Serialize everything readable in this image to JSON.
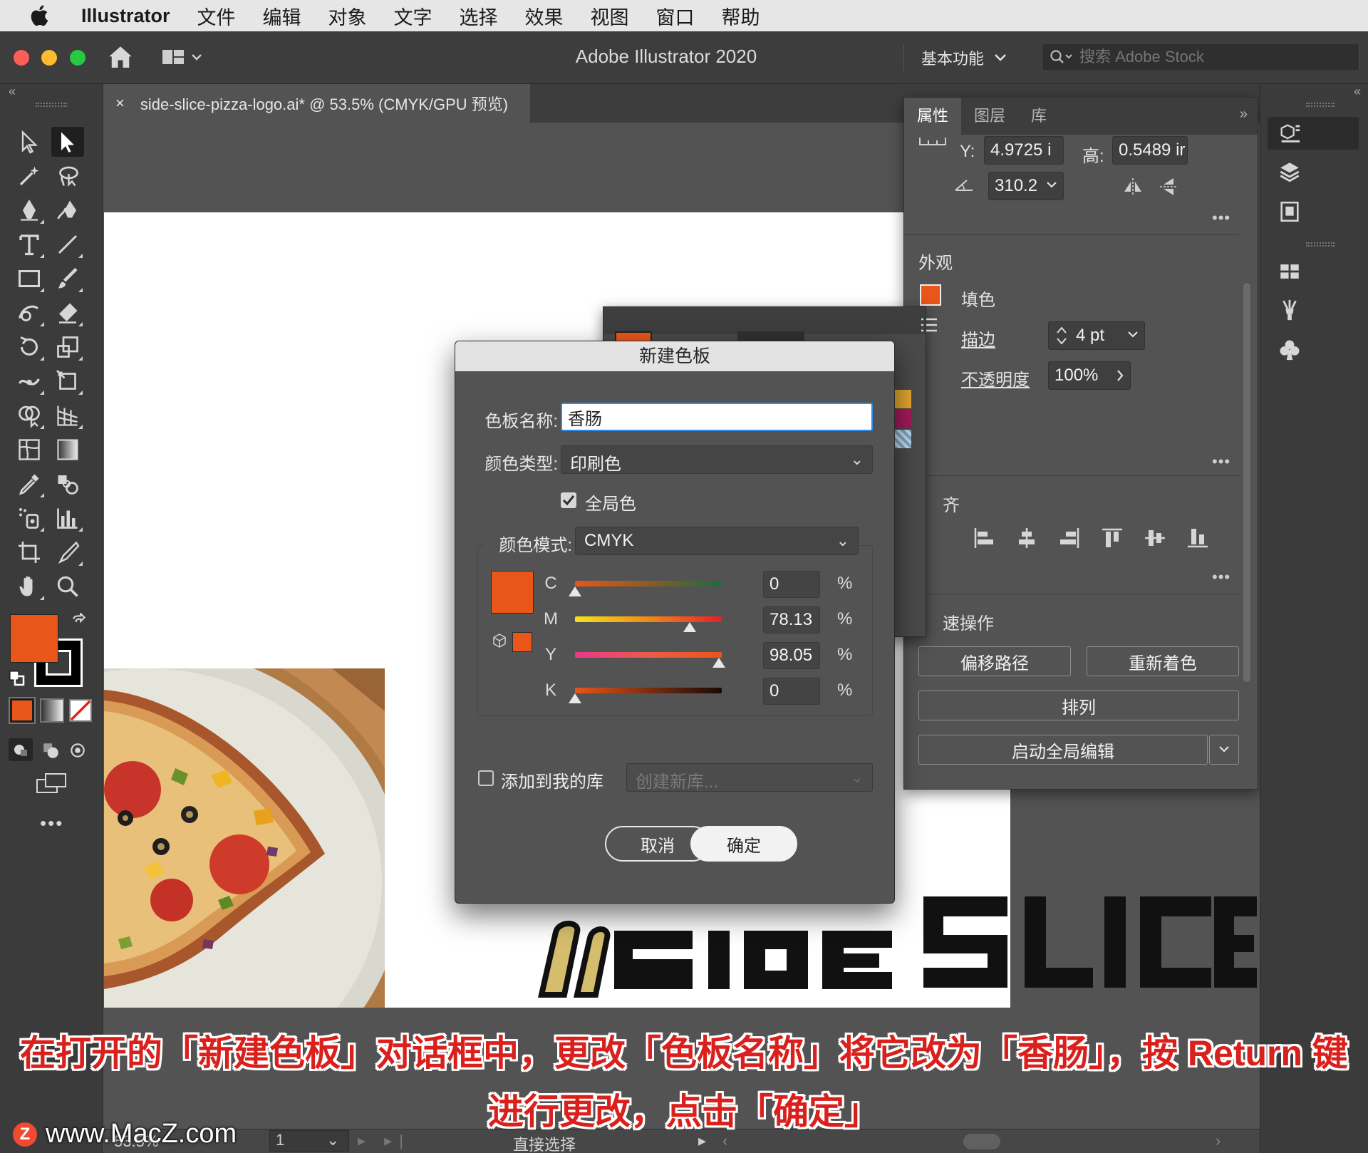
{
  "menubar": {
    "app_name": "Illustrator",
    "items": [
      "文件",
      "编辑",
      "对象",
      "文字",
      "选择",
      "效果",
      "视图",
      "窗口",
      "帮助"
    ]
  },
  "titlebar": {
    "title": "Adobe Illustrator 2020",
    "workspace": "基本功能",
    "search_placeholder": "搜索 Adobe Stock"
  },
  "document_tab": {
    "close": "×",
    "title": "side-slice-pizza-logo.ai* @ 53.5% (CMYK/GPU 预览)"
  },
  "properties_panel": {
    "tabs": [
      "属性",
      "图层",
      "库"
    ],
    "active_tab": "属性",
    "transform": {
      "y_label": "Y:",
      "y_value": "4.9725 i",
      "h_label": "高:",
      "h_value": "0.5489 ir",
      "angle_value": "310.2"
    },
    "appearance": {
      "heading": "外观",
      "fill_label": "填色",
      "stroke_label": "描边",
      "stroke_value": "4 pt",
      "opacity_label": "不透明度",
      "opacity_value": "100%"
    },
    "align_heading_fragment": "齐",
    "quick_actions": {
      "heading_fragment": "速操作",
      "offset_path": "偏移路径",
      "recolor": "重新着色",
      "arrange": "排列",
      "global_edit": "启动全局编辑"
    },
    "more": "•••"
  },
  "dialog": {
    "title": "新建色板",
    "swatch_name_label": "色板名称:",
    "swatch_name_value": "香肠",
    "color_type_label": "颜色类型:",
    "color_type_value": "印刷色",
    "global_label": "全局色",
    "global_checked": true,
    "color_mode_label": "颜色模式:",
    "color_mode_value": "CMYK",
    "channels": [
      {
        "label": "C",
        "value": "0",
        "unit": "%",
        "fraction": 0.0
      },
      {
        "label": "M",
        "value": "78.13",
        "unit": "%",
        "fraction": 0.7813
      },
      {
        "label": "Y",
        "value": "98.05",
        "unit": "%",
        "fraction": 0.9805
      },
      {
        "label": "K",
        "value": "0",
        "unit": "%",
        "fraction": 0.0
      }
    ],
    "add_to_library_label": "添加到我的库",
    "add_to_library_checked": false,
    "new_library_placeholder": "创建新库...",
    "cancel_label": "取消",
    "ok_label": "确定",
    "swatch_color": "#e8561a"
  },
  "statusbar": {
    "zoom": "53.5%",
    "page": "1",
    "current_tool": "直接选择"
  },
  "caption": {
    "line1": "在打开的「新建色板」对话框中，更改「色板名称」将它改为「香肠」，按 Return 键",
    "line2": "进行更改，点击「确定」"
  },
  "watermark": {
    "badge": "Z",
    "text": "www.MacZ.com"
  },
  "colors": {
    "accent_orange": "#e8561a",
    "caption_red": "#d9201c",
    "focus_blue": "#2d8ceb"
  }
}
